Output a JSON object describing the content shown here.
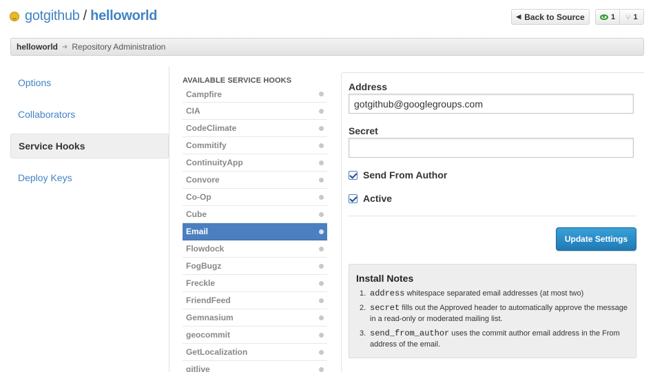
{
  "header": {
    "owner": "gotgithub",
    "separator": "/",
    "repo": "helloworld",
    "back_button": "Back to Source",
    "watchers": "1",
    "forks": "1"
  },
  "breadcrumb": {
    "repo": "helloworld",
    "page": "Repository Administration"
  },
  "admin_nav": {
    "items": [
      "Options",
      "Collaborators",
      "Service Hooks",
      "Deploy Keys"
    ],
    "selected": "Service Hooks"
  },
  "hooks": {
    "heading": "AVAILABLE SERVICE HOOKS",
    "items": [
      "Campfire",
      "CIA",
      "CodeClimate",
      "Commitify",
      "ContinuityApp",
      "Convore",
      "Co-Op",
      "Cube",
      "Email",
      "Flowdock",
      "FogBugz",
      "Freckle",
      "FriendFeed",
      "Gemnasium",
      "geocommit",
      "GetLocalization",
      "gitlive"
    ],
    "selected": "Email"
  },
  "settings": {
    "address_label": "Address",
    "address_value": "gotgithub@googlegroups.com",
    "secret_label": "Secret",
    "secret_value": "",
    "send_from_author_label": "Send From Author",
    "send_from_author_checked": true,
    "active_label": "Active",
    "active_checked": true,
    "update_button": "Update Settings"
  },
  "install_notes": {
    "title": "Install Notes",
    "items": [
      {
        "num": "1.",
        "code": "address",
        "text": " whitespace separated email addresses (at most two)"
      },
      {
        "num": "2.",
        "code": "secret",
        "text": " fills out the Approved header to automatically approve the message in a read-only or moderated mailing list."
      },
      {
        "num": "3.",
        "code": "send_from_author",
        "text": " uses the commit author email address in the From address of the email."
      }
    ]
  },
  "colors": {
    "link": "#4183c4",
    "selected_hook_bg": "#4b7fc0",
    "update_button": "#1f7ab5"
  }
}
